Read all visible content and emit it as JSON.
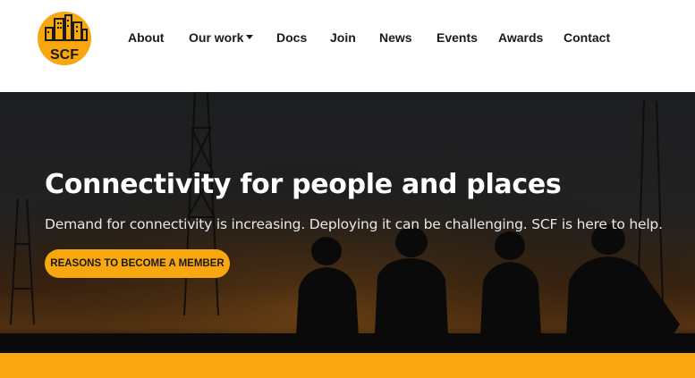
{
  "brand": {
    "logo_text": "SCF",
    "logo_color": "#f9a70f"
  },
  "nav": {
    "items": [
      {
        "label": "About"
      },
      {
        "label": "Our work",
        "has_dropdown": true
      },
      {
        "label": "Docs"
      },
      {
        "label": "Join"
      },
      {
        "label": "News"
      },
      {
        "label": "Events"
      },
      {
        "label": "Awards"
      },
      {
        "label": "Contact"
      }
    ]
  },
  "hero": {
    "title": "Connectivity for people and places",
    "subtitle": "Demand for connectivity is increasing. Deploying it can be challenging. SCF is here to help.",
    "cta_label": "REASONS TO BECOME A MEMBER",
    "accent_color": "#f9a70f"
  }
}
